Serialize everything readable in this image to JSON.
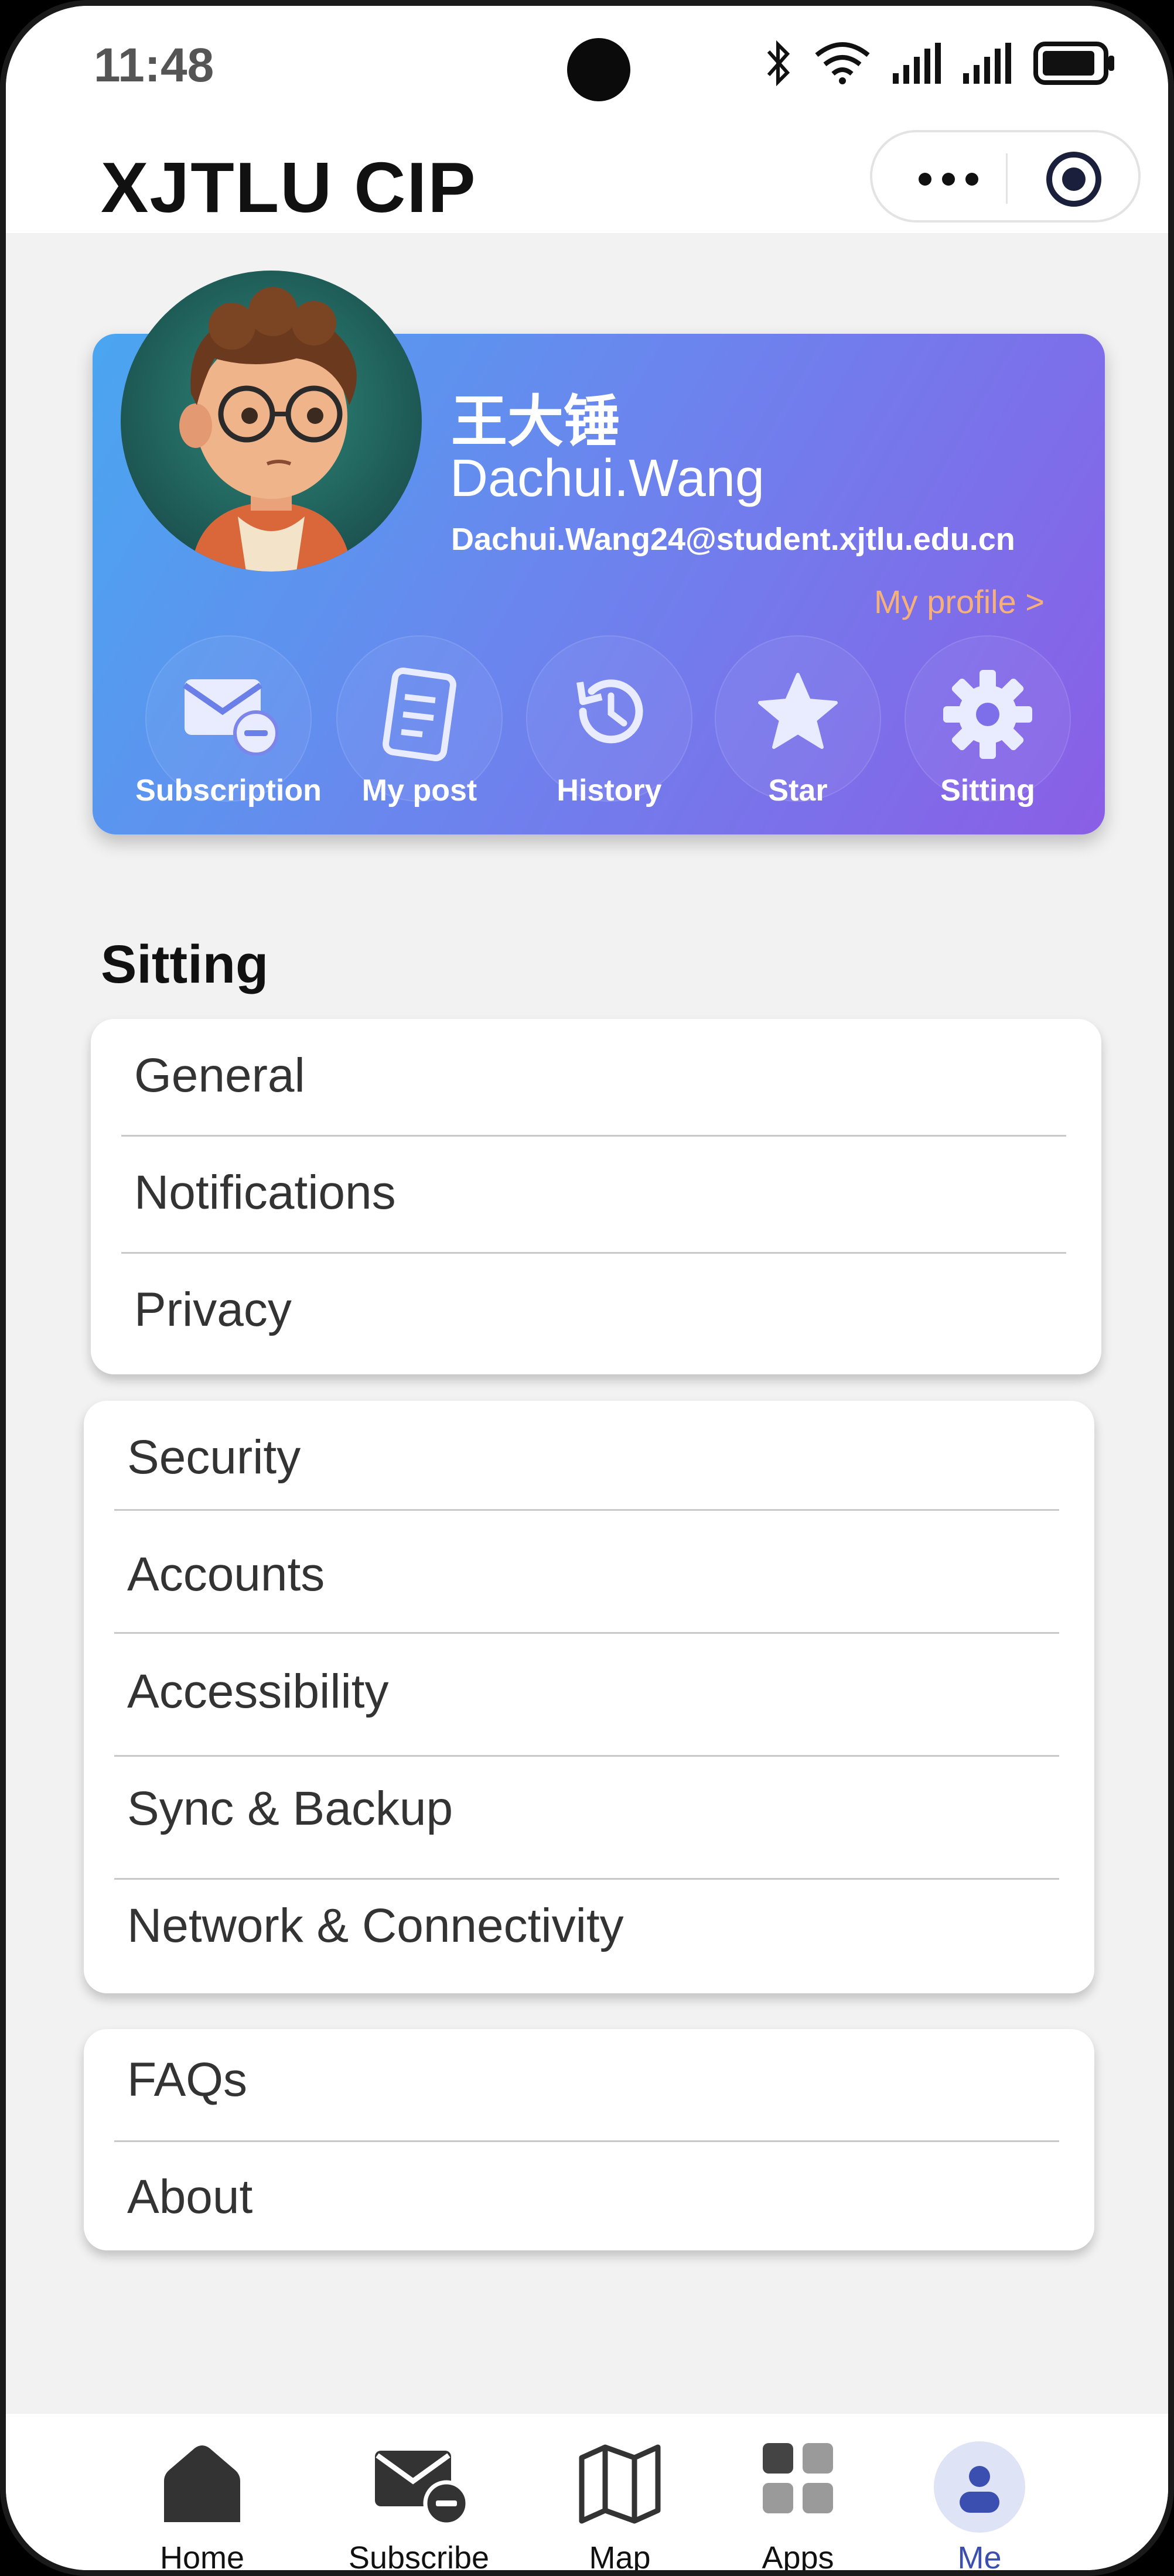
{
  "status_bar": {
    "time": "11:48"
  },
  "header": {
    "title": "XJTLU  CIP",
    "more_icon": "more-dots-icon",
    "close_icon": "target-close-icon"
  },
  "profile": {
    "name_cn": "王大锤",
    "name_en": "Dachui.Wang",
    "email": "Dachui.Wang24@student.xjtlu.edu.cn",
    "my_profile_link": "My profile >",
    "quick_actions": [
      {
        "label": "Subscription",
        "icon": "mail-minus-icon"
      },
      {
        "label": "My post",
        "icon": "document-icon"
      },
      {
        "label": "History",
        "icon": "history-icon"
      },
      {
        "label": "Star",
        "icon": "star-icon"
      },
      {
        "label": "Sitting",
        "icon": "gear-icon"
      }
    ]
  },
  "settings": {
    "title": "Sitting",
    "group1": [
      "General",
      "Notifications",
      "Privacy"
    ],
    "group2": [
      "Security",
      "Accounts",
      "Accessibility",
      "Sync & Backup",
      "Network & Connectivity"
    ],
    "group3": [
      "FAQs",
      "About"
    ]
  },
  "bottom_nav": [
    {
      "label": "Home",
      "icon": "home-icon"
    },
    {
      "label": "Subscribe",
      "icon": "mail-minus-icon"
    },
    {
      "label": "Map",
      "icon": "map-icon"
    },
    {
      "label": "Apps",
      "icon": "apps-grid-icon"
    },
    {
      "label": "Me",
      "icon": "person-icon",
      "active": true
    }
  ],
  "colors": {
    "card_gradient_start": "#4aa6f0",
    "card_gradient_end": "#8a5ee6",
    "link_orange": "#f6b07a",
    "nav_active": "#3b4fb0",
    "background": "#f2f2f2"
  }
}
